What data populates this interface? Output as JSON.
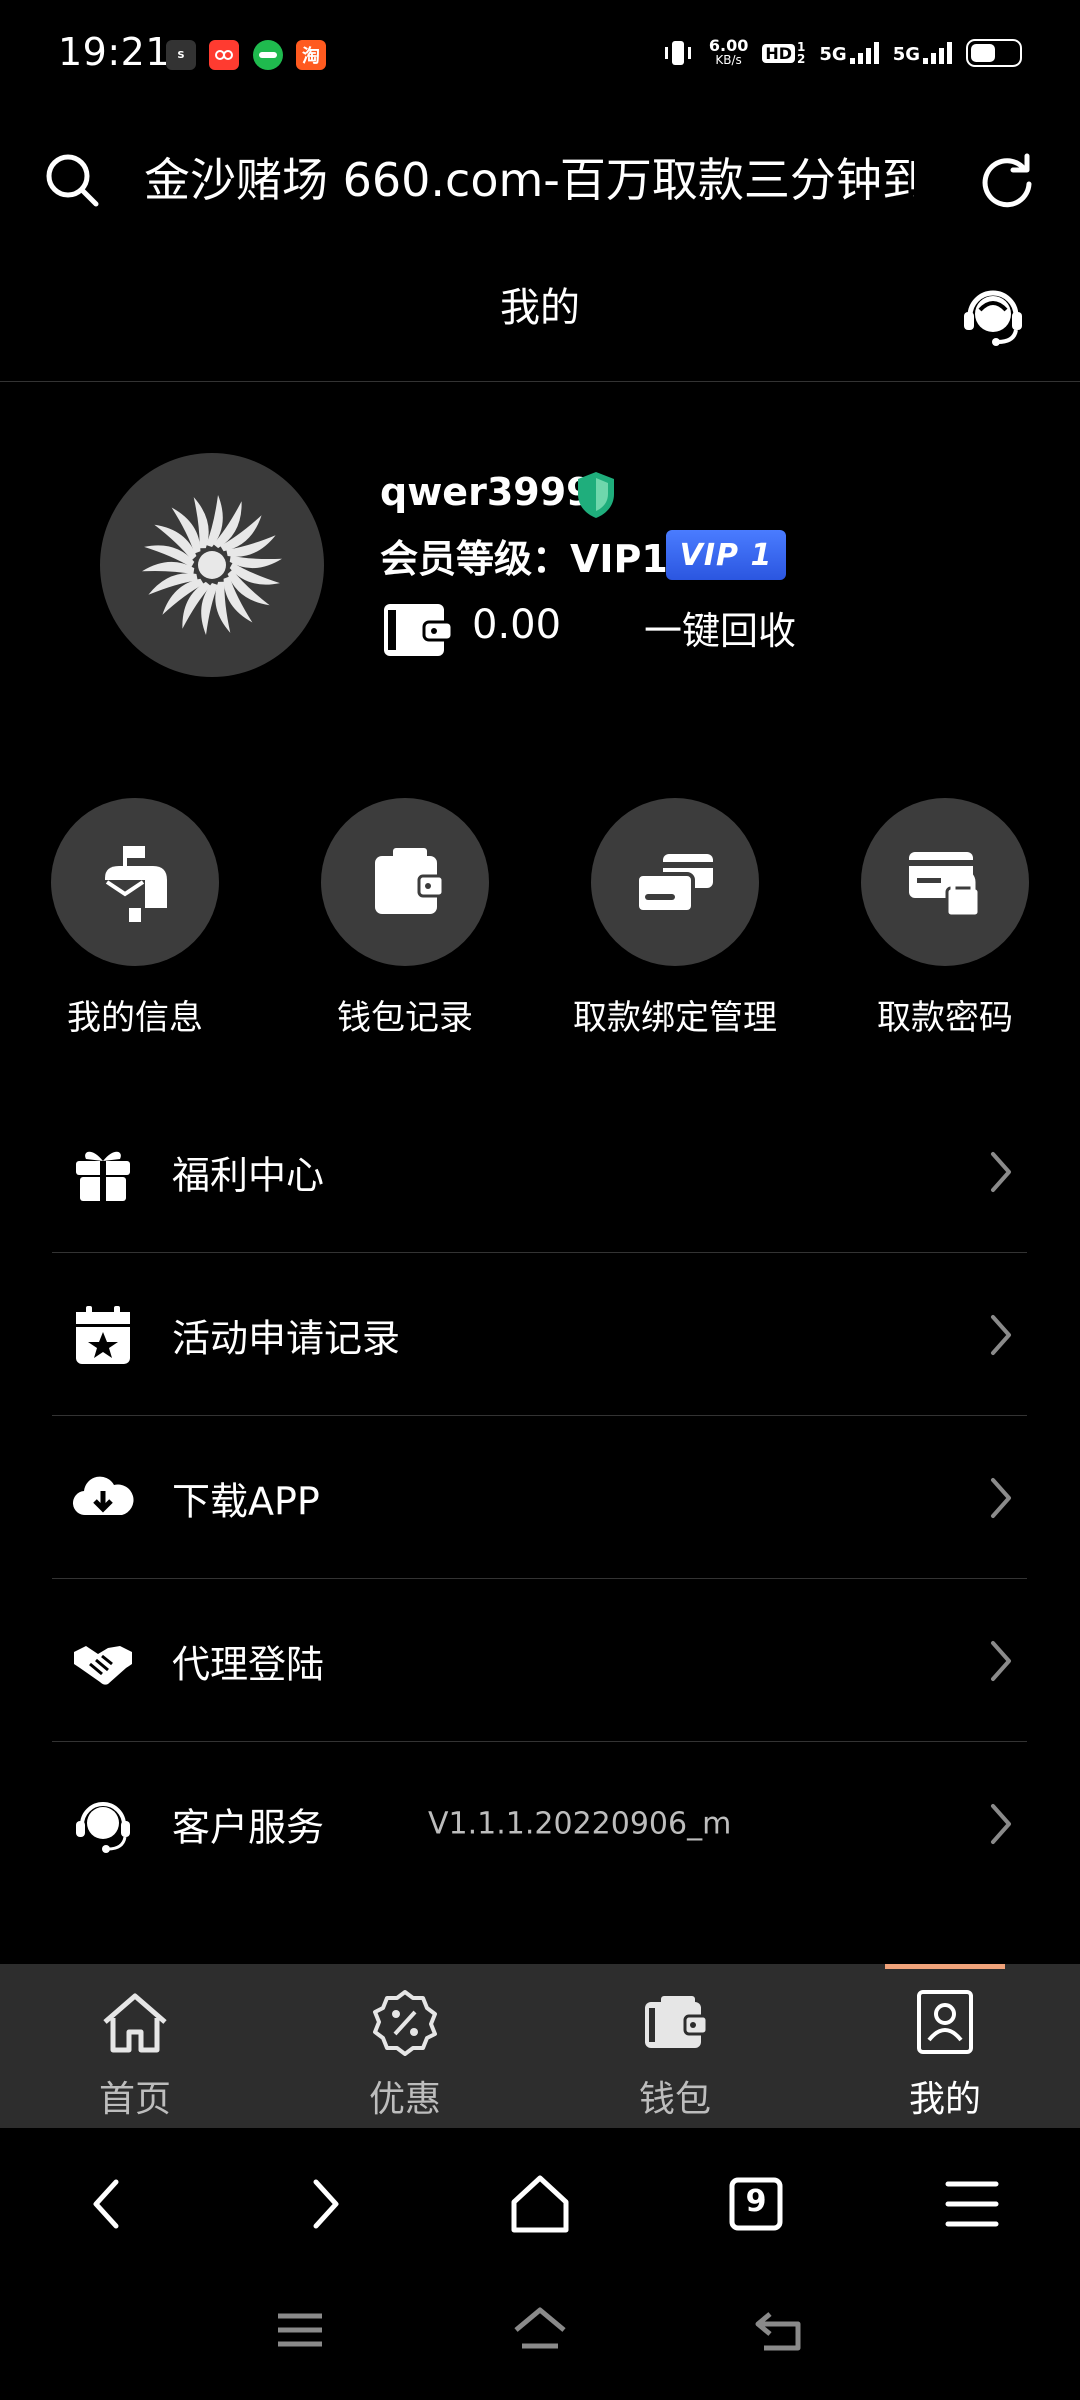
{
  "status_bar": {
    "time": "19:21",
    "net_speed_value": "6.00",
    "net_speed_unit": "KB/s",
    "hd_label": "HD",
    "signal_1": "5G",
    "signal_2": "5G",
    "apps": [
      "Soul",
      "小红书",
      "PDD",
      "淘宝"
    ]
  },
  "browser": {
    "url_title": "金沙赌场 660.com-百万取款三分钟到",
    "search_icon": "search-icon",
    "refresh_icon": "refresh-icon"
  },
  "header": {
    "title": "我的",
    "support_icon": "headset-icon"
  },
  "profile": {
    "username": "qwer3999",
    "member_level_label": "会员等级：VIP1",
    "vip_badge": "VIP 1",
    "balance": "0.00",
    "recycle_label": "一键回收",
    "colors": {
      "shield": "#1fae7c",
      "vip_badge": "#3d6bf2"
    }
  },
  "quick_actions": [
    {
      "label": "我的信息",
      "icon": "mailbox-icon"
    },
    {
      "label": "钱包记录",
      "icon": "wallet-icon"
    },
    {
      "label": "取款绑定管理",
      "icon": "cards-icon"
    },
    {
      "label": "取款密码",
      "icon": "card-lock-icon"
    }
  ],
  "menu": [
    {
      "label": "福利中心",
      "icon": "gift-icon"
    },
    {
      "label": "活动申请记录",
      "icon": "calendar-star-icon"
    },
    {
      "label": "下载APP",
      "icon": "cloud-download-icon"
    },
    {
      "label": "代理登陆",
      "icon": "handshake-icon"
    },
    {
      "label": "客户服务",
      "icon": "headset-icon",
      "extra": "V1.1.1.20220906_m"
    }
  ],
  "tabbar": {
    "active_index": 3,
    "accent": "#f0a27a",
    "tabs": [
      {
        "label": "首页",
        "icon": "home-icon"
      },
      {
        "label": "优惠",
        "icon": "discount-icon"
      },
      {
        "label": "钱包",
        "icon": "wallet-icon"
      },
      {
        "label": "我的",
        "icon": "profile-icon"
      }
    ]
  },
  "browser_nav": {
    "tab_count": "9"
  }
}
